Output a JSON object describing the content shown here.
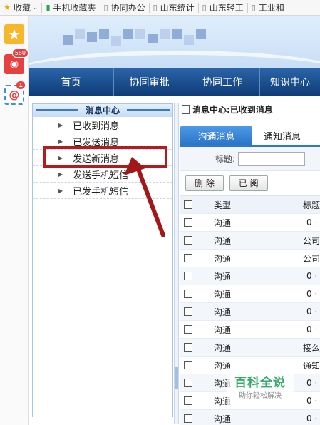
{
  "bookmarks": [
    {
      "label": "收藏",
      "icon": "star-folder-icon"
    },
    {
      "label": "手机收藏夹",
      "icon": "phone-icon"
    },
    {
      "label": "协同办公",
      "icon": "page-icon"
    },
    {
      "label": "山东统计",
      "icon": "page-icon"
    },
    {
      "label": "山东轻工",
      "icon": "page-icon"
    },
    {
      "label": "工业和",
      "icon": "page-icon"
    }
  ],
  "sidebar": {
    "weibo_badge": "580",
    "mail_badge": "1"
  },
  "nav": {
    "items": [
      "首页",
      "协同审批",
      "协同工作",
      "知识中心"
    ]
  },
  "left_panel": {
    "title": "消息中心",
    "items": [
      "已收到消息",
      "已发送消息",
      "发送新消息",
      "发送手机短信",
      "已发手机短信"
    ]
  },
  "right_panel": {
    "title": "消息中心:已收到消息",
    "tabs": [
      "沟通消息",
      "通知消息"
    ],
    "search_label": "标题:",
    "search_value": "",
    "buttons": [
      "删 除",
      "已 阅"
    ],
    "table": {
      "headers": [
        "类型",
        "标题"
      ],
      "rows": [
        {
          "type": "沟通",
          "title": "0 ·"
        },
        {
          "type": "沟通",
          "title": "公司"
        },
        {
          "type": "沟通",
          "title": "公司"
        },
        {
          "type": "沟通",
          "title": "0 ·"
        },
        {
          "type": "沟通",
          "title": "0 ·"
        },
        {
          "type": "沟通",
          "title": "0 ·"
        },
        {
          "type": "沟通",
          "title": "0 ·"
        },
        {
          "type": "沟通",
          "title": "接么"
        },
        {
          "type": "沟通",
          "title": "通知"
        },
        {
          "type": "沟通",
          "title": "0 ·"
        },
        {
          "type": "沟通",
          "title": "0 ·"
        },
        {
          "type": "沟通",
          "title": "0 ·"
        }
      ]
    }
  },
  "watermark": {
    "main": "百科全说",
    "sub": "助你轻松解决"
  },
  "colors": {
    "nav_bg": "#1a4d8c",
    "highlight": "#b11d1d",
    "tab_active": "#2a73c6"
  }
}
